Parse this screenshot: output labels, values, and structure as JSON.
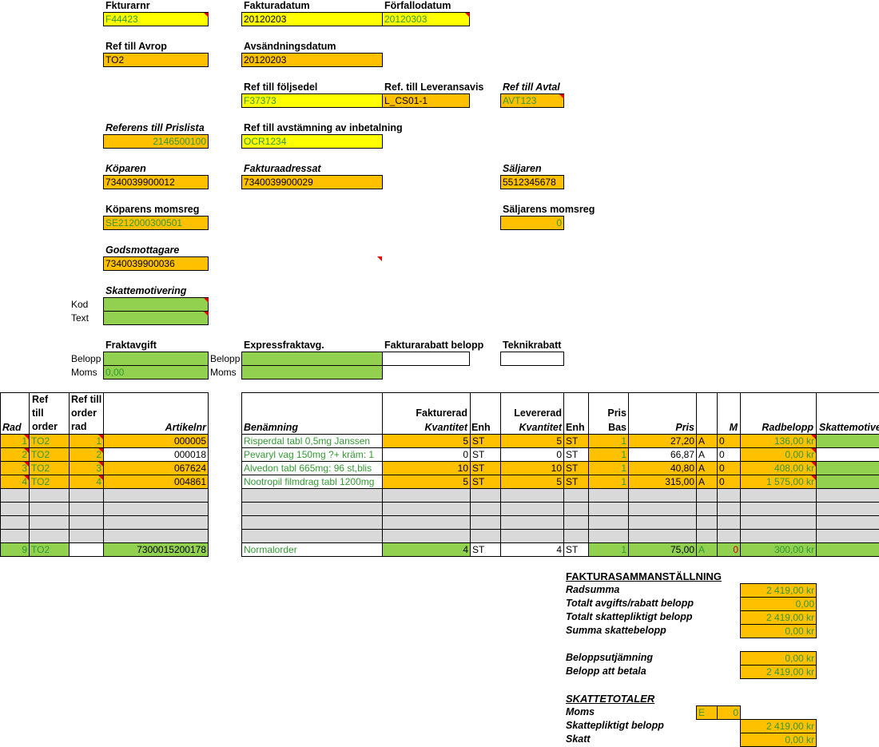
{
  "header": {
    "fakturanr": {
      "label": "Fkturarnr",
      "value": "F44423"
    },
    "fakturadatum": {
      "label": "Fakturadatum",
      "value": "20120203"
    },
    "forfallodatum": {
      "label": "Förfallodatum",
      "value": "20120303"
    },
    "ref_avrop": {
      "label": "Ref till Avrop",
      "value": "TO2"
    },
    "avsandningsdatum": {
      "label": "Avsändningsdatum",
      "value": "20120203"
    },
    "ref_foljsedel": {
      "label": "Ref till följsedel",
      "value": "F37373"
    },
    "ref_leveransavis": {
      "label": "Ref. till Leveransavis",
      "value": "L_CS01-1"
    },
    "ref_avtal": {
      "label": "Ref till Avtal",
      "value": "AVT123"
    },
    "ref_prislista": {
      "label": "Referens till Prislista",
      "value": "2146500100"
    },
    "ref_avstamning": {
      "label": "Ref till avstämning av inbetalning",
      "value": "OCR1234"
    },
    "koparen": {
      "label": "Köparen",
      "value": "7340039900012"
    },
    "fakturaadressat": {
      "label": "Fakturaadressat",
      "value": "7340039900029"
    },
    "saljaren": {
      "label": "Säljaren",
      "value": "5512345678"
    },
    "koparens_momsreg": {
      "label": "Köparens momsreg",
      "value": "SE212000300501"
    },
    "saljarens_momsreg": {
      "label": "Säljarens momsreg",
      "value": "0"
    },
    "godsmottagare": {
      "label": "Godsmottagare",
      "value": "7340039900036"
    },
    "skattemotivering": {
      "label": "Skattemotivering",
      "kod_label": "Kod",
      "text_label": "Text"
    },
    "fraktavgift": {
      "label": "Fraktavgift",
      "belopp_label": "Belopp",
      "moms_label": "Moms",
      "moms_value": "0,00"
    },
    "expressfrakt": {
      "label": "Expressfraktavg.",
      "belopp_label": "Belopp",
      "moms_label": "Moms"
    },
    "fakturarabatt": {
      "label": "Fakturarabatt belopp"
    },
    "teknikrabatt": {
      "label": "Teknikrabatt"
    }
  },
  "table": {
    "headers": {
      "rad": "Rad",
      "ref_order": [
        "Ref",
        "till",
        "order"
      ],
      "ref_order_rad": [
        "Ref till",
        "order",
        "rad"
      ],
      "artikelnr": "Artikelnr",
      "benamning": "Benämning",
      "fakturerad": [
        "Fakturerad",
        "Kvantitet"
      ],
      "enh1": "Enh",
      "levererad": [
        "Levererad",
        "Kvantitet"
      ],
      "enh2": "Enh",
      "pris_bas": [
        "Pris",
        "Bas"
      ],
      "pris": "Pris",
      "m": "M",
      "radbelopp": "Radbelopp",
      "skattemotiv": "Skattemotive"
    },
    "rows": [
      {
        "rad": "1",
        "order": "TO2",
        "orad": "1",
        "art": "000005",
        "ben": "Risperdal tabl 0,5mg Janssen",
        "fkv": "5",
        "enh1": "ST",
        "lkv": "5",
        "enh2": "ST",
        "bas": "1",
        "pris": "27,20",
        "a": "A",
        "m": "0",
        "belopp": "136,00 kr"
      },
      {
        "rad": "2",
        "order": "TO2",
        "orad": "2",
        "art": "000018",
        "ben": "Pevaryl vag 150mg ?+ kräm: 1",
        "fkv": "0",
        "enh1": "ST",
        "lkv": "0",
        "enh2": "ST",
        "bas": "1",
        "pris": "66,87",
        "a": "A",
        "m": "0",
        "belopp": "0,00 kr"
      },
      {
        "rad": "3",
        "order": "TO2",
        "orad": "3",
        "art": "067624",
        "ben": "Alvedon tabl 665mg: 96 st,blis",
        "fkv": "10",
        "enh1": "ST",
        "lkv": "10",
        "enh2": "ST",
        "bas": "1",
        "pris": "40,80",
        "a": "A",
        "m": "0",
        "belopp": "408,00 kr"
      },
      {
        "rad": "4",
        "order": "TO2",
        "orad": "4",
        "art": "004861",
        "ben": "Nootropil filmdrag tabl 1200mg",
        "fkv": "5",
        "enh1": "ST",
        "lkv": "5",
        "enh2": "ST",
        "bas": "1",
        "pris": "315,00",
        "a": "A",
        "m": "0",
        "belopp": "1 575,00 kr"
      }
    ],
    "extra_row": {
      "rad": "9",
      "order": "TO2",
      "orad": "",
      "art": "7300015200178",
      "ben": "Normalorder",
      "fkv": "4",
      "enh1": "ST",
      "lkv": "4",
      "enh2": "ST",
      "bas": "1",
      "pris": "75,00",
      "a": "A",
      "m": "0",
      "belopp": "300,00 kr"
    }
  },
  "summary": {
    "title": "FAKTURASAMMANSTÄLLNING",
    "radsumma": {
      "label": "Radsumma",
      "value": "2 419,00 kr"
    },
    "avgifts_rabatt": {
      "label": "Totalt avgifts/rabatt belopp",
      "value": "0,00"
    },
    "skattepliktigt": {
      "label": "Totalt skattepliktigt belopp",
      "value": "2 419,00 kr"
    },
    "skattebelopp": {
      "label": "Summa skattebelopp",
      "value": "0,00 kr"
    },
    "utjamning": {
      "label": "Beloppsutjämning",
      "value": "0,00 kr"
    },
    "att_betala": {
      "label": "Belopp att betala",
      "value": "2 419,00 kr"
    }
  },
  "skattetotaler": {
    "title": "SKATTETOTALER",
    "moms": {
      "label": "Moms",
      "code": "E",
      "value": "0"
    },
    "skattepliktigt": {
      "label": "Skattepliktigt belopp",
      "value": "2 419,00 kr"
    },
    "skatt": {
      "label": "Skatt",
      "value": "0,00 kr"
    }
  },
  "colors": {
    "yellow": "#ffff00",
    "orange": "#ffc000",
    "green": "#92d050",
    "grey": "#d9d9d9",
    "text_green": "#339933",
    "comment_red": "#e00000"
  }
}
